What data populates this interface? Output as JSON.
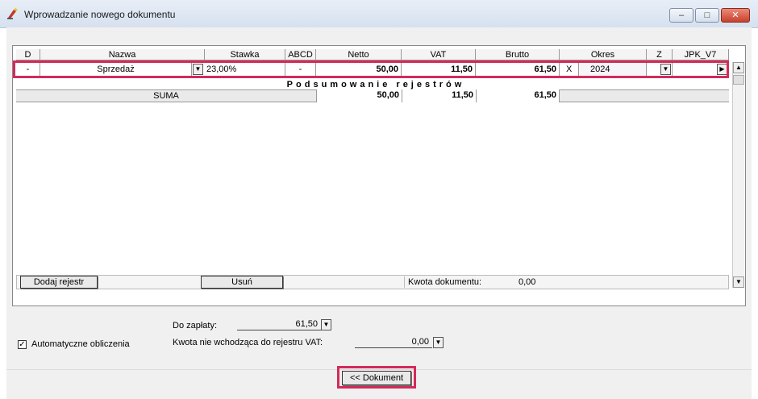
{
  "window": {
    "title": "Wprowadzanie nowego dokumentu",
    "min": "–",
    "max": "□",
    "close": "✕"
  },
  "grid": {
    "headers": [
      "D",
      "Nazwa",
      "Stawka",
      "ABCD",
      "Netto",
      "VAT",
      "Brutto",
      "Okres",
      "Z",
      "JPK_V7"
    ],
    "row": {
      "d": "-",
      "nazwa": "Sprzedaż",
      "stawka": "23,00%",
      "abcd": "-",
      "netto": "50,00",
      "vat": "11,50",
      "brutto": "61,50",
      "okres_x": "X",
      "okres_year": "2024",
      "z": "",
      "jpk": ""
    },
    "summary_title": "Podsumowanie rejestrów",
    "suma": {
      "label": "SUMA",
      "netto": "50,00",
      "vat": "11,50",
      "brutto": "61,50"
    }
  },
  "footer": {
    "add_label": "Dodaj rejestr",
    "remove_label": "Usuń",
    "kwota_label": "Kwota dokumentu:",
    "kwota_value": "0,00"
  },
  "form": {
    "do_zaplaty_label": "Do zapłaty:",
    "do_zaplaty_value": "61,50",
    "kwota_nie_label": "Kwota nie wchodząca do rejestru VAT:",
    "kwota_nie_value": "0,00",
    "auto_label": "Automatyczne obliczenia",
    "auto_checked": true
  },
  "nav": {
    "dokument_label": "<< Dokument"
  },
  "colors": {
    "highlight": "#d42a5a"
  }
}
